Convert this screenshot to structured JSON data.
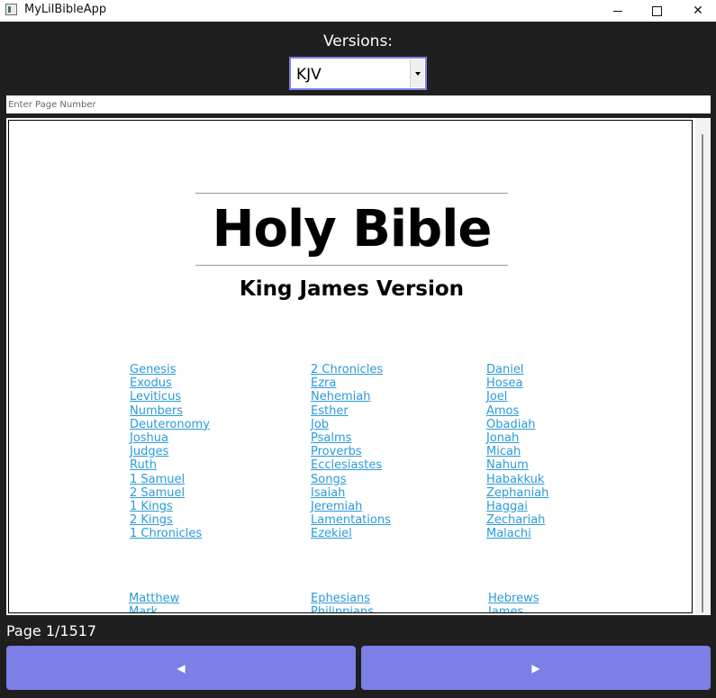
{
  "window": {
    "title": "MyLilBibleApp",
    "minimize_glyph": "",
    "maximize_glyph": "",
    "close_glyph": "✕"
  },
  "header": {
    "versions_label": "Versions:",
    "version_selected": "KJV"
  },
  "page_input": {
    "placeholder": "Enter Page Number",
    "value": ""
  },
  "document": {
    "title": "Holy Bible",
    "subtitle": "King James Version",
    "old_testament": {
      "col1": [
        "Genesis",
        "Exodus",
        "Leviticus",
        "Numbers",
        "Deuteronomy",
        "Joshua",
        "Judges",
        "Ruth",
        "1 Samuel",
        "2 Samuel",
        "1 Kings",
        "2 Kings",
        "1 Chronicles"
      ],
      "col2": [
        "2 Chronicles",
        "Ezra",
        "Nehemiah",
        "Esther",
        "Job",
        "Psalms",
        "Proverbs",
        "Ecclesiastes",
        "Songs",
        "Isaiah",
        "Jeremiah",
        "Lamentations",
        "Ezekiel"
      ],
      "col3": [
        "Daniel",
        "Hosea",
        "Joel",
        "Amos",
        "Obadiah",
        "Jonah",
        "Micah",
        "Nahum",
        "Habakkuk",
        "Zephaniah",
        "Haggai",
        "Zechariah",
        "Malachi"
      ]
    },
    "new_testament": {
      "col1": [
        "Matthew",
        "Mark"
      ],
      "col2": [
        "Ephesians",
        "Philippians"
      ],
      "col3": [
        "Hebrews",
        "James"
      ]
    }
  },
  "footer": {
    "page_indicator": "Page 1/1517",
    "prev_label": "◀",
    "next_label": "▶"
  }
}
